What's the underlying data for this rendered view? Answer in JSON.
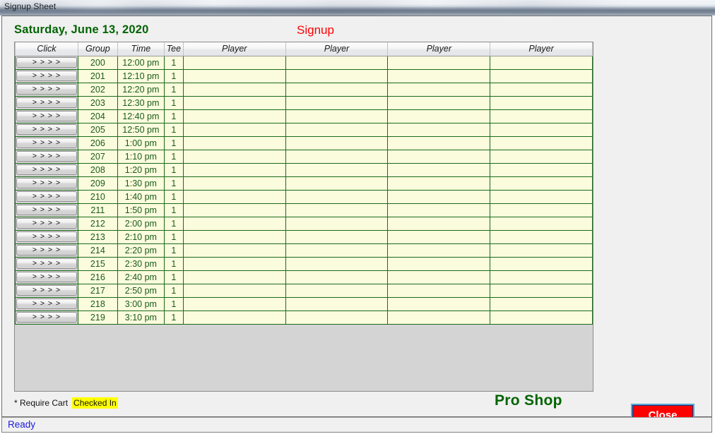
{
  "window": {
    "title": "Signup Sheet"
  },
  "header": {
    "date": "Saturday, June 13, 2020",
    "signup_title": "Signup"
  },
  "grid": {
    "columns": [
      "Click",
      "Group",
      "Time",
      "Tee",
      "Player",
      "Player",
      "Player",
      "Player"
    ],
    "click_button_label": "> > > >",
    "rows": [
      {
        "group": "200",
        "time": "12:00 pm",
        "tee": "1",
        "players": [
          "",
          "",
          "",
          ""
        ]
      },
      {
        "group": "201",
        "time": "12:10 pm",
        "tee": "1",
        "players": [
          "",
          "",
          "",
          ""
        ]
      },
      {
        "group": "202",
        "time": "12:20 pm",
        "tee": "1",
        "players": [
          "",
          "",
          "",
          ""
        ]
      },
      {
        "group": "203",
        "time": "12:30 pm",
        "tee": "1",
        "players": [
          "",
          "",
          "",
          ""
        ]
      },
      {
        "group": "204",
        "time": "12:40 pm",
        "tee": "1",
        "players": [
          "",
          "",
          "",
          ""
        ]
      },
      {
        "group": "205",
        "time": "12:50 pm",
        "tee": "1",
        "players": [
          "",
          "",
          "",
          ""
        ]
      },
      {
        "group": "206",
        "time": "1:00 pm",
        "tee": "1",
        "players": [
          "",
          "",
          "",
          ""
        ]
      },
      {
        "group": "207",
        "time": "1:10 pm",
        "tee": "1",
        "players": [
          "",
          "",
          "",
          ""
        ]
      },
      {
        "group": "208",
        "time": "1:20 pm",
        "tee": "1",
        "players": [
          "",
          "",
          "",
          ""
        ]
      },
      {
        "group": "209",
        "time": "1:30 pm",
        "tee": "1",
        "players": [
          "",
          "",
          "",
          ""
        ]
      },
      {
        "group": "210",
        "time": "1:40 pm",
        "tee": "1",
        "players": [
          "",
          "",
          "",
          ""
        ]
      },
      {
        "group": "211",
        "time": "1:50 pm",
        "tee": "1",
        "players": [
          "",
          "",
          "",
          ""
        ]
      },
      {
        "group": "212",
        "time": "2:00 pm",
        "tee": "1",
        "players": [
          "",
          "",
          "",
          ""
        ]
      },
      {
        "group": "213",
        "time": "2:10 pm",
        "tee": "1",
        "players": [
          "",
          "",
          "",
          ""
        ]
      },
      {
        "group": "214",
        "time": "2:20 pm",
        "tee": "1",
        "players": [
          "",
          "",
          "",
          ""
        ]
      },
      {
        "group": "215",
        "time": "2:30 pm",
        "tee": "1",
        "players": [
          "",
          "",
          "",
          ""
        ]
      },
      {
        "group": "216",
        "time": "2:40 pm",
        "tee": "1",
        "players": [
          "",
          "",
          "",
          ""
        ]
      },
      {
        "group": "217",
        "time": "2:50 pm",
        "tee": "1",
        "players": [
          "",
          "",
          "",
          ""
        ]
      },
      {
        "group": "218",
        "time": "3:00 pm",
        "tee": "1",
        "players": [
          "",
          "",
          "",
          ""
        ]
      },
      {
        "group": "219",
        "time": "3:10 pm",
        "tee": "1",
        "players": [
          "",
          "",
          "",
          ""
        ]
      }
    ]
  },
  "footer": {
    "require_cart_legend": "* Require Cart",
    "checked_in_legend": "Checked In",
    "pro_shop_label": "Pro Shop",
    "close_label": "Close"
  },
  "statusbar": {
    "text": "Ready"
  },
  "colors": {
    "date_green": "#006400",
    "signup_red": "#ff0000",
    "cell_yellow": "#fbfbdd",
    "cell_border_green": "#1a6b1a",
    "cell_text_green": "#1a5c1a",
    "highlight_yellow": "#ffff00",
    "close_red": "#ff0000",
    "close_border_blue": "#5aa9d6",
    "status_blue": "#1b1bdd"
  }
}
